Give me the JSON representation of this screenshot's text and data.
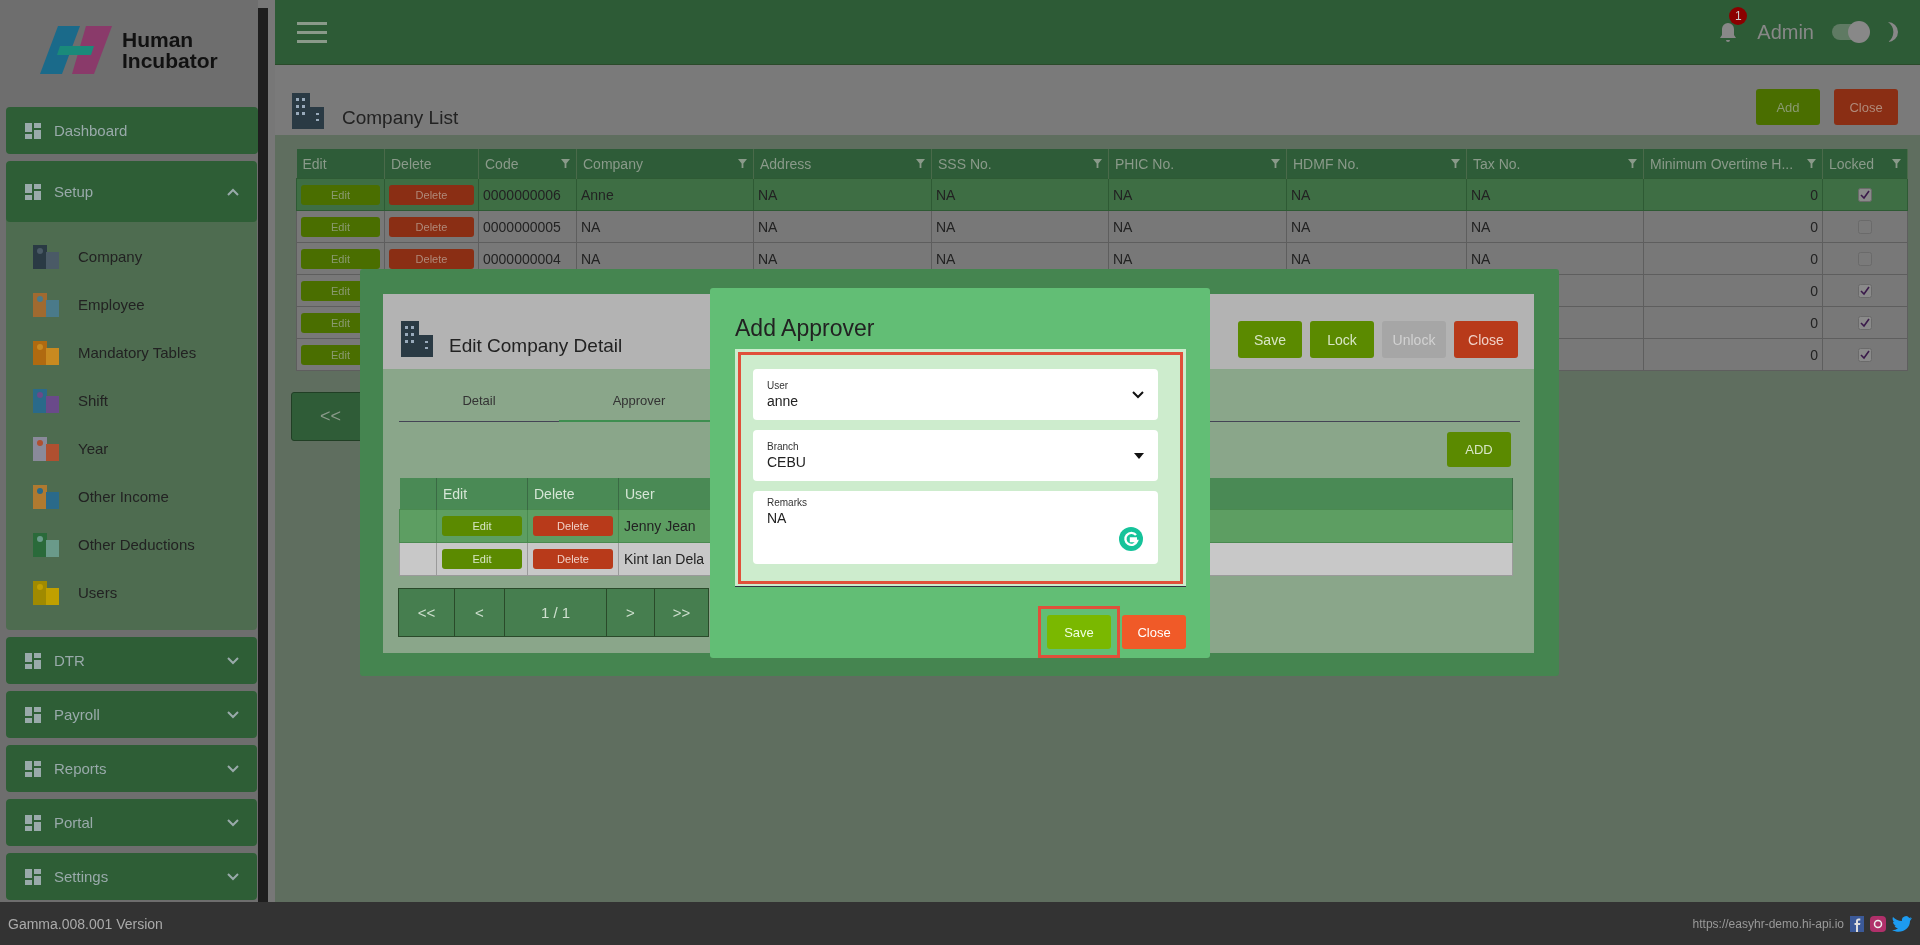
{
  "sidebar": {
    "logo": {
      "line1": "Human",
      "line2": "Incubator"
    },
    "items": [
      {
        "label": "Dashboard",
        "kind": "link"
      },
      {
        "label": "Setup",
        "kind": "group",
        "expanded": true,
        "children": [
          {
            "label": "Company"
          },
          {
            "label": "Employee"
          },
          {
            "label": "Mandatory Tables"
          },
          {
            "label": "Shift"
          },
          {
            "label": "Year"
          },
          {
            "label": "Other Income"
          },
          {
            "label": "Other Deductions"
          },
          {
            "label": "Users"
          }
        ]
      },
      {
        "label": "DTR",
        "kind": "group",
        "expanded": false
      },
      {
        "label": "Payroll",
        "kind": "group",
        "expanded": false
      },
      {
        "label": "Reports",
        "kind": "group",
        "expanded": false
      },
      {
        "label": "Portal",
        "kind": "group",
        "expanded": false
      },
      {
        "label": "Settings",
        "kind": "group",
        "expanded": false
      }
    ]
  },
  "topbar": {
    "notifications": "1",
    "user": "Admin",
    "dark_mode": {
      "on": true
    }
  },
  "page": {
    "title": "Company List",
    "buttons": [
      {
        "label": "Add",
        "kind": "primary"
      },
      {
        "label": "Close",
        "kind": "danger"
      }
    ],
    "table": {
      "columns": [
        {
          "label": "Edit",
          "filter": false
        },
        {
          "label": "Delete",
          "filter": false
        },
        {
          "label": "Code",
          "filter": true
        },
        {
          "label": "Company",
          "filter": true
        },
        {
          "label": "Address",
          "filter": true
        },
        {
          "label": "SSS No.",
          "filter": true
        },
        {
          "label": "PHIC No.",
          "filter": true
        },
        {
          "label": "HDMF No.",
          "filter": true
        },
        {
          "label": "Tax No.",
          "filter": true
        },
        {
          "label": "Minimum Overtime H...",
          "filter": true
        },
        {
          "label": "Locked",
          "filter": true
        }
      ],
      "rows": [
        {
          "selected": true,
          "edit": "Edit",
          "delete": "Delete",
          "code": "0000000006",
          "company": "Anne",
          "address": "NA",
          "sss_no": "NA",
          "phic_no": "NA",
          "hdmf_no": "NA",
          "tax_no": "NA",
          "min_overtime": "0",
          "locked": true
        },
        {
          "selected": false,
          "edit": "Edit",
          "delete": "Delete",
          "code": "0000000005",
          "company": "NA",
          "address": "NA",
          "sss_no": "NA",
          "phic_no": "NA",
          "hdmf_no": "NA",
          "tax_no": "NA",
          "min_overtime": "0",
          "locked": false
        },
        {
          "selected": false,
          "edit": "Edit",
          "delete": "Delete",
          "code": "0000000004",
          "company": "NA",
          "address": "NA",
          "sss_no": "NA",
          "phic_no": "NA",
          "hdmf_no": "NA",
          "tax_no": "NA",
          "min_overtime": "0",
          "locked": false
        },
        {
          "selected": false,
          "edit": "Edit",
          "min_overtime": "0",
          "locked": true
        },
        {
          "selected": false,
          "edit": "Edit",
          "min_overtime": "0",
          "locked": true
        },
        {
          "selected": false,
          "edit": "Edit",
          "min_overtime": "0",
          "locked": true
        }
      ]
    },
    "pager_first": "<<"
  },
  "edit_dialog": {
    "title": "Edit Company Detail",
    "buttons": [
      {
        "label": "Save",
        "kind": "primary",
        "disabled": false
      },
      {
        "label": "Lock",
        "kind": "primary",
        "disabled": false
      },
      {
        "label": "Unlock",
        "kind": "primary",
        "disabled": true
      },
      {
        "label": "Close",
        "kind": "danger",
        "disabled": false
      }
    ],
    "tabs": [
      {
        "label": "Detail",
        "selected": false
      },
      {
        "label": "Approver",
        "selected": true
      }
    ],
    "add_button": "ADD",
    "table": {
      "columns": [
        "Edit",
        "Delete",
        "User"
      ],
      "rows": [
        {
          "selected": true,
          "edit": "Edit",
          "delete": "Delete",
          "user": "Jenny Jean"
        },
        {
          "selected": false,
          "edit": "Edit",
          "delete": "Delete",
          "user": "Kint Ian Dela"
        }
      ]
    },
    "pager": [
      "<<",
      "<",
      "1 / 1",
      ">",
      ">>"
    ]
  },
  "approver_dialog": {
    "title": "Add Approver",
    "highlighted": true,
    "fields": [
      {
        "kind": "select",
        "label": "User",
        "value": "anne"
      },
      {
        "kind": "dropdown",
        "label": "Branch",
        "value": "CEBU"
      },
      {
        "kind": "textarea",
        "label": "Remarks",
        "value": "NA"
      }
    ],
    "buttons": [
      {
        "label": "Save",
        "kind": "primary",
        "highlighted": true
      },
      {
        "label": "Close",
        "kind": "danger",
        "highlighted": false
      }
    ]
  },
  "footer": {
    "version": "Gamma.008.001 Version",
    "url": "https://easyhr-demo.hi-api.io"
  }
}
